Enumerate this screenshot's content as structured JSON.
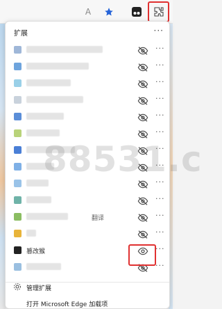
{
  "toolbar": {
    "read_aloud_label": "A",
    "buttons": [
      "read-aloud",
      "favorites-star",
      "tampermonkey",
      "extensions"
    ]
  },
  "panel": {
    "title": "扩展",
    "more_label": "···"
  },
  "extensions": [
    {
      "color": "#9fb7d8",
      "label": "",
      "eye": "hidden"
    },
    {
      "color": "#6ea4dd",
      "label": "",
      "eye": "hidden"
    },
    {
      "color": "#9ad0e8",
      "label": "",
      "eye": "hidden"
    },
    {
      "color": "#c9d2dc",
      "label": "",
      "eye": "hidden"
    },
    {
      "color": "#5b8ed8",
      "label": "",
      "eye": "hidden"
    },
    {
      "color": "#b9d37a",
      "label": "",
      "eye": "hidden"
    },
    {
      "color": "#4a7fd6",
      "label": "",
      "eye": "hidden"
    },
    {
      "color": "#7fb0e6",
      "label": "",
      "eye": "hidden"
    },
    {
      "color": "#9ac3e8",
      "label": "",
      "eye": "hidden"
    },
    {
      "color": "#6fb3a8",
      "label": "",
      "eye": "hidden"
    },
    {
      "color": "#8bbd62",
      "label": "",
      "suffix": "翻译",
      "eye": "hidden"
    },
    {
      "color": "#e8b43a",
      "label": "",
      "eye": "hidden"
    },
    {
      "color": "#222222",
      "label": "篡改猴",
      "eye": "visible"
    },
    {
      "color": "#9abfe0",
      "label": "",
      "eye": "hidden"
    }
  ],
  "footer": {
    "manage_label": "管理扩展",
    "addons_label": "打开 Microsoft Edge 加载项"
  },
  "watermark": "88531.c"
}
